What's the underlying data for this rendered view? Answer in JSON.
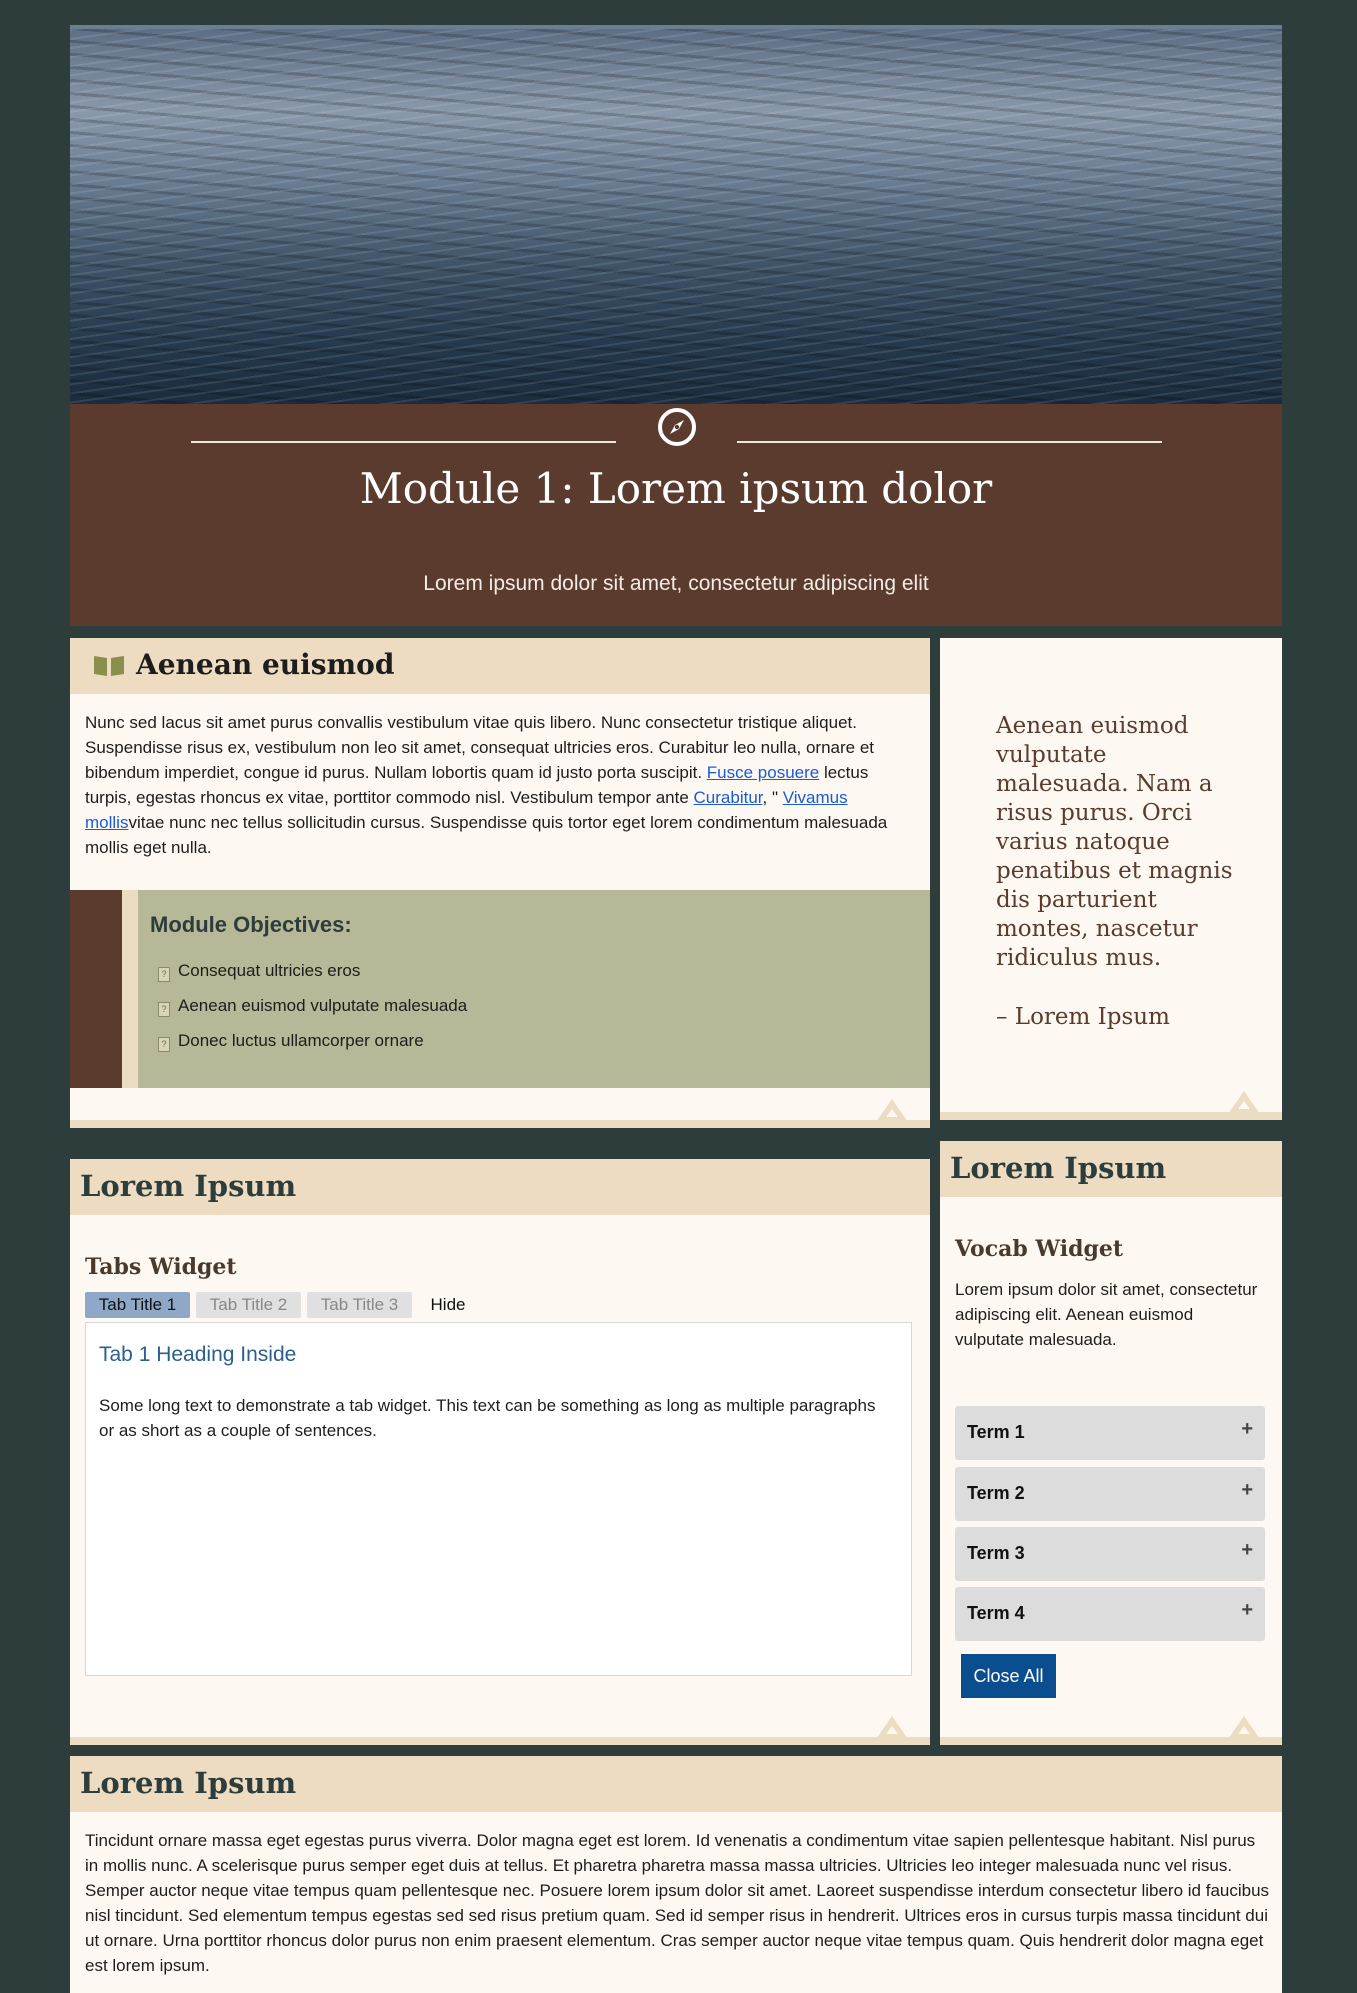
{
  "hero": {
    "image_alt": "water-waves"
  },
  "banner": {
    "icon": "compass-icon",
    "title": "Module 1: Lorem ipsum dolor",
    "subtitle": "Lorem ipsum dolor sit amet, consectetur adipiscing elit"
  },
  "intro": {
    "icon": "book-icon",
    "heading": "Aenean euismod",
    "p1": "Nunc sed lacus sit amet purus convallis vestibulum vitae quis libero. Nunc consectetur tristique aliquet. Suspendisse risus ex, vestibulum non leo sit amet, consequat ultricies eros. Curabitur leo nulla, ornare et bibendum imperdiet, congue id purus. Nullam lobortis quam id justo porta suscipit. ",
    "link1": "Fusce posuere",
    "p2": " lectus turpis, egestas rhoncus ex vitae, porttitor commodo nisl. Vestibulum tempor ante ",
    "link2": "Curabitur",
    "p3": ", \" ",
    "link3": "Vivamus mollis",
    "p4": "vitae nunc nec tellus sollicitudin cursus. Suspendisse quis tortor eget lorem condimentum malesuada mollis eget nulla.",
    "objectives_title": "Module Objectives:",
    "objectives": [
      "Consequat ultricies eros",
      "Aenean euismod vulputate malesuada",
      "Donec luctus ullamcorper ornare"
    ]
  },
  "quote": {
    "text": "Aenean euismod vulputate malesuada. Nam a risus purus. Orci varius natoque penatibus et magnis dis parturient montes, nascetur ridiculus mus.",
    "author": "– Lorem Ipsum"
  },
  "tabs_card": {
    "heading": "Lorem Ipsum",
    "widget_title": "Tabs Widget",
    "tabs": [
      "Tab Title 1",
      "Tab Title 2",
      "Tab Title 3",
      "Hide"
    ],
    "panel_heading": "Tab 1 Heading Inside",
    "panel_text": "Some long text to demonstrate a tab widget. This text can be something as long as multiple paragraphs or as short as a couple of sentences."
  },
  "vocab_card": {
    "heading": "Lorem Ipsum",
    "widget_title": "Vocab Widget",
    "text": "Lorem ipsum dolor sit amet, consectetur adipiscing elit. Aenean euismod vulputate malesuada.",
    "terms": [
      "Term 1",
      "Term 2",
      "Term 3",
      "Term 4"
    ],
    "close_all": "Close All"
  },
  "bottom_card": {
    "heading": "Lorem Ipsum",
    "text": "Tincidunt ornare massa eget egestas purus viverra. Dolor magna eget est lorem. Id venenatis a condimentum vitae sapien pellentesque habitant. Nisl purus in mollis nunc. A scelerisque purus semper eget duis at tellus. Et pharetra pharetra massa massa ultricies. Ultricies leo integer malesuada nunc vel risus. Semper auctor neque vitae tempus quam pellentesque nec. Posuere lorem ipsum dolor sit amet. Laoreet suspendisse interdum consectetur libero id faucibus nisl tincidunt. Sed elementum tempus egestas sed sed risus pretium quam. Sed id semper risus in hendrerit. Ultrices eros in cursus turpis massa tincidunt dui ut ornare. Urna porttitor rhoncus dolor purus non enim praesent elementum. Cras semper auctor neque vitae tempus quam. Quis hendrerit dolor magna eget est lorem ipsum."
  },
  "colors": {
    "background": "#2d3d3c",
    "banner": "#5a3b2e",
    "card": "#fdf8f1",
    "header_bar": "#eddcc1",
    "objectives": "#b6b897",
    "active_tab": "#8fa8c8",
    "button": "#0b4e8f"
  }
}
